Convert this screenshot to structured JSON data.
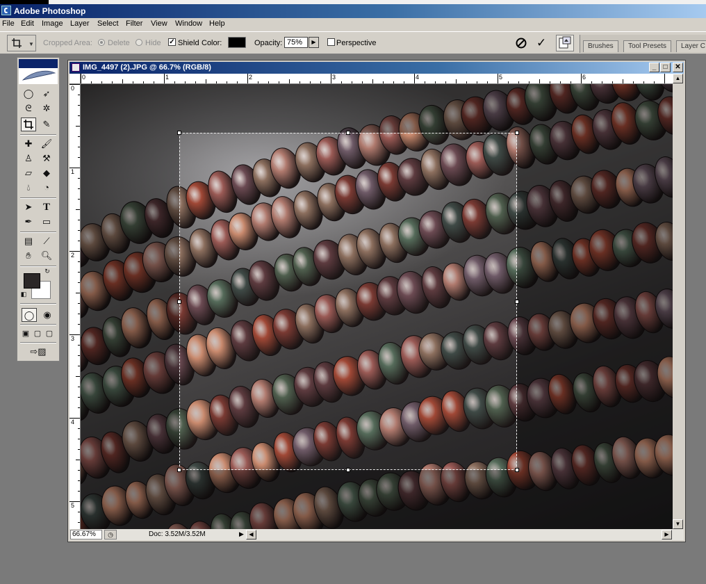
{
  "app": {
    "title": "Adobe Photoshop"
  },
  "menu": {
    "items": [
      "File",
      "Edit",
      "Image",
      "Layer",
      "Select",
      "Filter",
      "View",
      "Window",
      "Help"
    ]
  },
  "options": {
    "cropped_area_label": "Cropped Area:",
    "delete_label": "Delete",
    "hide_label": "Hide",
    "shield_label": "Shield",
    "shield_checked": "✓",
    "color_label": "Color:",
    "shield_color": "#000000",
    "opacity_label": "Opacity:",
    "opacity_value": "75%",
    "opacity_arrow": "▶",
    "perspective_label": "Perspective",
    "commit_glyph": "✓",
    "tool_preset_arrow": "▼"
  },
  "palette_well": {
    "tabs": [
      "Brushes",
      "Tool Presets",
      "Layer C"
    ]
  },
  "toolbox": {
    "foreground_color": "#2b2727",
    "background_color": "#ffffff"
  },
  "document": {
    "title": "IMG_4497 (2).JPG @ 66.7% (RGB/8)",
    "minimize": "_",
    "maximize": "□",
    "close": "✕",
    "zoom": "66.67%",
    "doc_size": "Doc: 3.52M/3.52M",
    "status_arrow": "▶",
    "scroll_left": "◀",
    "scroll_right": "▶",
    "scroll_up": "▲",
    "scroll_down": "▼",
    "ruler_top": [
      "0",
      "1",
      "2",
      "3",
      "4",
      "5",
      "6"
    ],
    "ruler_left": [
      "0",
      "1",
      "2",
      "3",
      "4",
      "5"
    ]
  }
}
